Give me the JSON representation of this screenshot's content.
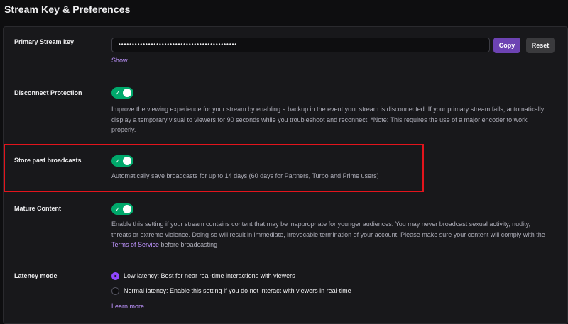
{
  "page": {
    "title": "Stream Key & Preferences"
  },
  "stream_key": {
    "label": "Primary Stream key",
    "value": "••••••••••••••••••••••••••••••••••••••••••••",
    "copy_label": "Copy",
    "reset_label": "Reset",
    "show_label": "Show"
  },
  "disconnect_protection": {
    "label": "Disconnect Protection",
    "enabled": true,
    "line1": "Improve the viewing experience for your stream by enabling a backup in the event your stream is disconnected. If your primary stream fails, automatically",
    "line2": "display a temporary visual to viewers for 90 seconds while you troubleshoot and reconnect. *Note: This requires the use of a major encoder to work",
    "line3": "properly."
  },
  "past_broadcasts": {
    "label": "Store past broadcasts",
    "enabled": true,
    "description": "Automatically save broadcasts for up to 14 days (60 days for Partners, Turbo and Prime users)"
  },
  "mature_content": {
    "label": "Mature Content",
    "enabled": true,
    "line1": "Enable this setting if your stream contains content that may be inappropriate for younger audiences. You may never broadcast sexual activity, nudity,",
    "line2": "threats or extreme violence. Doing so will result in immediate, irrevocable termination of your account. Please make sure your content will comply with the",
    "terms_link": "Terms of Service",
    "line3_suffix": " before broadcasting"
  },
  "latency": {
    "label": "Latency mode",
    "options": [
      {
        "label": "Low latency: Best for near real-time interactions with viewers",
        "selected": true
      },
      {
        "label": "Normal latency: Enable this setting if you do not interact with viewers in real-time",
        "selected": false
      }
    ],
    "learn_more": "Learn more"
  },
  "colors": {
    "accent": "#9147ff",
    "toggle_on": "#00a86b",
    "highlight": "#e3141c"
  }
}
